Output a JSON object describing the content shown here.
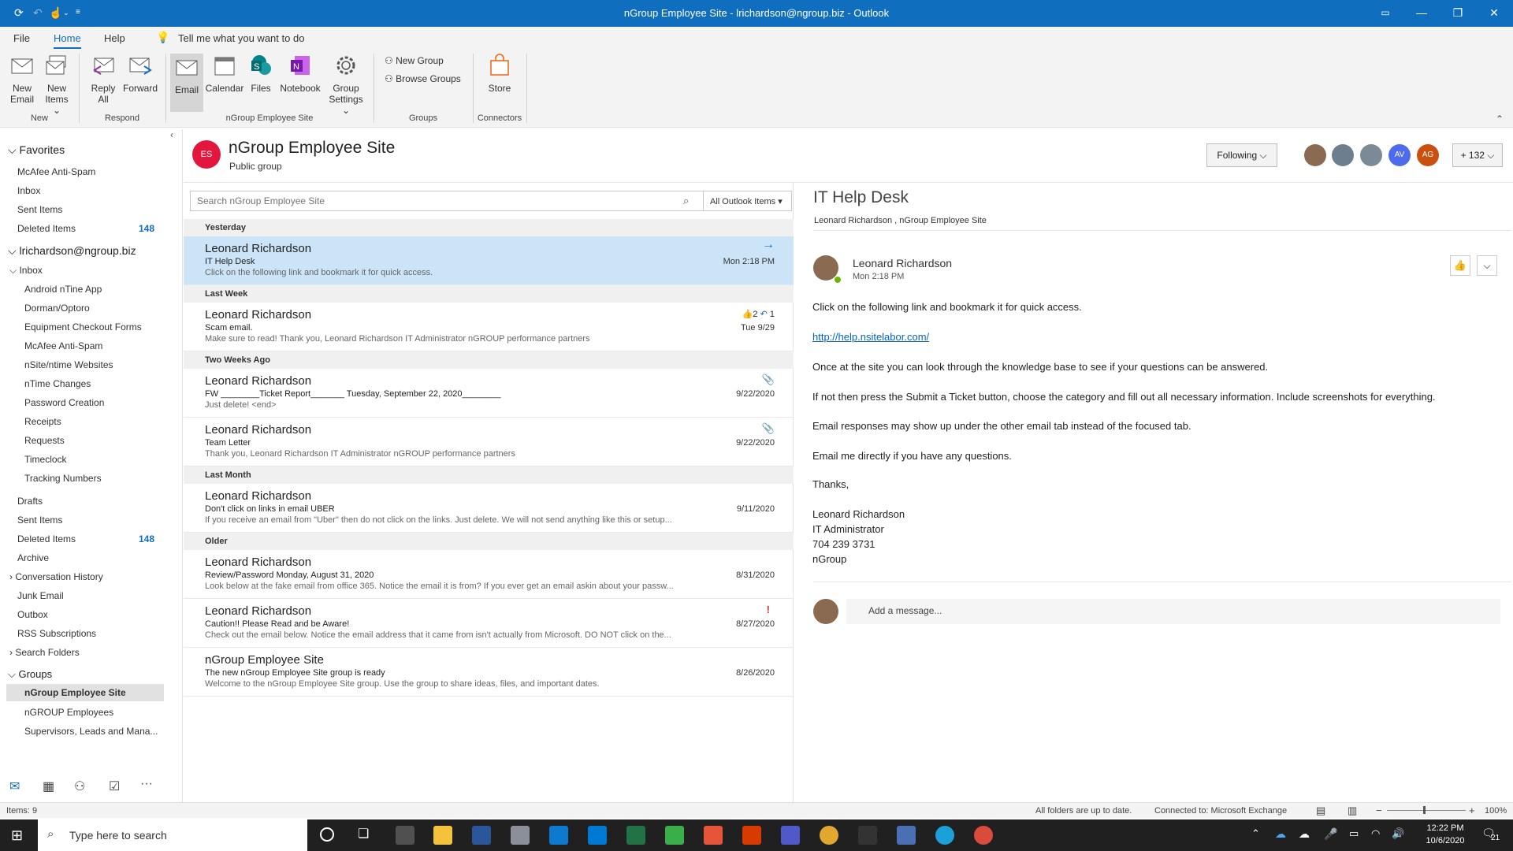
{
  "window": {
    "title": "nGroup Employee Site - lrichardson@ngroup.biz - Outlook"
  },
  "menu": {
    "file": "File",
    "home": "Home",
    "help": "Help",
    "tell": "Tell me what you want to do"
  },
  "ribbon": {
    "new_email": [
      "New",
      "Email"
    ],
    "new_items": [
      "New",
      "Items"
    ],
    "reply_all": [
      "Reply",
      "All"
    ],
    "forward": "Forward",
    "email": "Email",
    "calendar": "Calendar",
    "files": "Files",
    "notebook": "Notebook",
    "group_settings": [
      "Group",
      "Settings"
    ],
    "new_group": "New Group",
    "browse_groups": "Browse Groups",
    "store": "Store",
    "groups": {
      "new": "New",
      "respond": "Respond",
      "site": "nGroup Employee Site",
      "groups": "Groups",
      "connectors": "Connectors"
    }
  },
  "nav": {
    "favorites": "Favorites",
    "fav_items": [
      {
        "label": "McAfee Anti-Spam",
        "count": ""
      },
      {
        "label": "Inbox",
        "count": ""
      },
      {
        "label": "Sent Items",
        "count": ""
      },
      {
        "label": "Deleted Items",
        "count": "148"
      }
    ],
    "account": "lrichardson@ngroup.biz",
    "inbox": "Inbox",
    "inbox_sub": [
      "Android nTine App",
      "Dorman/Optoro",
      "Equipment Checkout Forms",
      "McAfee Anti-Spam",
      "nSite/ntime Websites",
      "nTime Changes",
      "Password Creation",
      "Receipts",
      "Requests",
      "Timeclock",
      "Tracking Numbers"
    ],
    "folders": [
      {
        "label": "Drafts",
        "count": ""
      },
      {
        "label": "Sent Items",
        "count": ""
      },
      {
        "label": "Deleted Items",
        "count": "148"
      },
      {
        "label": "Archive",
        "count": ""
      },
      {
        "label": "Conversation History",
        "count": ""
      },
      {
        "label": "Junk Email",
        "count": ""
      },
      {
        "label": "Outbox",
        "count": ""
      },
      {
        "label": "RSS Subscriptions",
        "count": ""
      },
      {
        "label": "Search Folders",
        "count": ""
      }
    ],
    "groups": "Groups",
    "group_items": [
      "nGroup Employee Site",
      "nGROUP Employees",
      "Supervisors, Leads and Mana..."
    ]
  },
  "header": {
    "initials": "ES",
    "title": "nGroup Employee Site",
    "subtitle": "Public group",
    "following": "Following",
    "members_more": "+ 132",
    "avatar_av": "AV",
    "avatar_ag": "AG"
  },
  "list": {
    "search_placeholder": "Search nGroup Employee Site",
    "scope": "All Outlook Items",
    "groups": {
      "yesterday": "Yesterday",
      "last_week": "Last Week",
      "two_weeks": "Two Weeks Ago",
      "last_month": "Last Month",
      "older": "Older"
    },
    "messages": [
      {
        "from": "Leonard Richardson",
        "subject": "IT Help Desk",
        "preview": "Click on the following link and bookmark it for quick access.",
        "date": "Mon 2:18 PM"
      },
      {
        "from": "Leonard Richardson",
        "subject": "Scam email.",
        "preview": "Make sure to read!  Thank you,  Leonard Richardson  IT Administrator  nGROUP performance partners",
        "date": "Tue 9/29",
        "likes": "2",
        "replies": "1"
      },
      {
        "from": "Leonard Richardson",
        "subject": "FW  ________Ticket Report_______  Tuesday, September 22, 2020________",
        "preview": "Just delete! <end>",
        "date": "9/22/2020"
      },
      {
        "from": "Leonard Richardson",
        "subject": "Team Letter",
        "preview": "Thank you,  Leonard Richardson  IT Administrator  nGROUP performance partners",
        "date": "9/22/2020"
      },
      {
        "from": "Leonard Richardson",
        "subject": "Don't click on links in email UBER",
        "preview": "If you receive an email from \"Uber\" then do not click on the links. Just delete. We will not send anything like this or setup...",
        "date": "9/11/2020"
      },
      {
        "from": "Leonard Richardson",
        "subject": "Review/Password Monday, August 31, 2020",
        "preview": "Look below at the fake email from office 365.  Notice the email it is from?  If you ever get an email askin about your passw...",
        "date": "8/31/2020"
      },
      {
        "from": "Leonard Richardson",
        "subject": "Caution!!  Please Read and be Aware!",
        "preview": "Check out the email below.  Notice the email address that it came from isn't actually from Microsoft.  DO NOT click on the...",
        "date": "8/27/2020"
      },
      {
        "from": "nGroup Employee Site",
        "subject": "The new nGroup Employee Site group is ready",
        "preview": "Welcome to the nGroup Employee Site group.  Use the group to share ideas, files, and important dates.",
        "date": "8/26/2020"
      }
    ]
  },
  "reading": {
    "subject": "IT Help Desk",
    "recipients": "Leonard Richardson , nGroup Employee Site",
    "sender": "Leonard Richardson",
    "time": "Mon 2:18 PM",
    "body": [
      "Click on the following link and bookmark it for quick access.",
      "http://help.nsitelabor.com/",
      "Once at the site you can look through the knowledge base to see if your questions can be answered.",
      "If not then press the Submit a Ticket button, choose the category and fill out all necessary information. Include screenshots for everything.",
      "Email responses may show up under the other email tab instead of the focused tab.",
      "Email me directly if you have any questions.",
      "Thanks,",
      "Leonard Richardson",
      "IT Administrator",
      "704 239 3731",
      "nGroup"
    ],
    "reply_placeholder": "Add a message..."
  },
  "status": {
    "items": "Items: 9",
    "sync": "All folders are up to date.",
    "connected": "Connected to: Microsoft Exchange",
    "zoom": "100%"
  },
  "taskbar": {
    "search": "Type here to search",
    "time": "12:22 PM",
    "date": "10/6/2020",
    "notif": "21"
  },
  "colors": {
    "accent": "#106ebe",
    "selected_row": "#cce4f7",
    "group_red": "#e3173e"
  }
}
